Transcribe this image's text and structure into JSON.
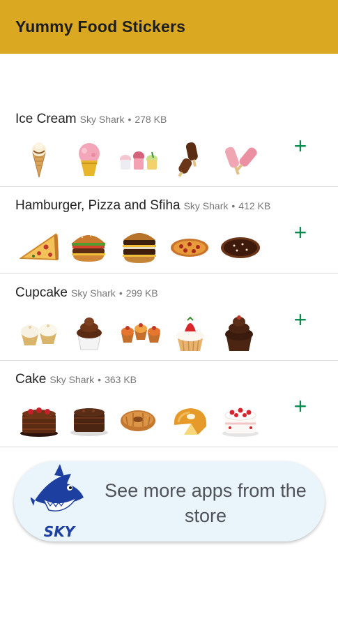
{
  "app": {
    "title": "Yummy Food Stickers"
  },
  "packs": [
    {
      "name": "Ice Cream",
      "author": "Sky Shark",
      "separator": "•",
      "size": "278 KB",
      "add_label": "+",
      "stickers": [
        "ice-cream-cone-sticker",
        "strawberry-ice-cream-cup-sticker",
        "ice-cream-cups-sticker",
        "chocolate-popsicles-sticker",
        "pink-popsicles-sticker"
      ]
    },
    {
      "name": "Hamburger, Pizza and Sfiha",
      "author": "Sky Shark",
      "separator": "•",
      "size": "412 KB",
      "add_label": "+",
      "stickers": [
        "pizza-slice-sticker",
        "hamburger-sticker",
        "double-burger-sticker",
        "pepperoni-pizza-sticker",
        "chocolate-pizza-sticker"
      ]
    },
    {
      "name": "Cupcake",
      "author": "Sky Shark",
      "separator": "•",
      "size": "299 KB",
      "add_label": "+",
      "stickers": [
        "vanilla-cupcakes-sticker",
        "chocolate-cupcake-sticker",
        "mini-cupcakes-sticker",
        "strawberry-cupcake-sticker",
        "chocolate-frosted-cupcake-sticker"
      ]
    },
    {
      "name": "Cake",
      "author": "Sky Shark",
      "separator": "•",
      "size": "363 KB",
      "add_label": "+",
      "stickers": [
        "chocolate-strawberry-cake-sticker",
        "chocolate-cake-sticker",
        "bundt-cake-sticker",
        "orange-bundt-cake-sticker",
        "strawberry-cream-cake-sticker"
      ]
    }
  ],
  "promo": {
    "text": "See more apps from the store",
    "logo_text": "SKY"
  },
  "colors": {
    "app_bar": "#dba822",
    "add_icon": "#0b8a4f",
    "promo_bg": "#eaf5fb",
    "logo_blue": "#1c3fa0"
  }
}
